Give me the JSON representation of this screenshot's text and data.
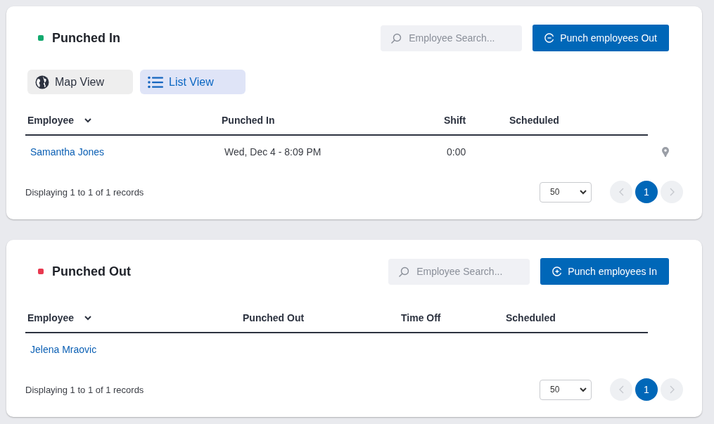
{
  "sections": [
    {
      "kind": "punched_in",
      "title": "Punched In",
      "color": "#12a96e",
      "search": {
        "placeholder": "Employee Search..."
      },
      "action_button": {
        "label": "Punch employees Out",
        "kind": "out"
      },
      "view_tabs": [
        {
          "label": "Map View",
          "kind": "map",
          "selected": false
        },
        {
          "label": "List View",
          "kind": "list",
          "selected": true
        }
      ],
      "table": {
        "columns": [
          {
            "label": "Employee",
            "sortable": true
          },
          {
            "label": "Punched In",
            "sortable": false
          },
          {
            "label": "Shift",
            "sortable": false
          },
          {
            "label": "Scheduled",
            "sortable": false
          }
        ],
        "rows": [
          {
            "cells": [
              "Samantha Jones",
              "Wed, Dec 4 - 8:09 PM",
              "0:00"
            ],
            "location": true
          }
        ]
      },
      "footer": {
        "summary": "Displaying 1 to 1 of 1 records",
        "page_size": "50",
        "prev_disabled": true,
        "next_disabled": true,
        "pages": [
          {
            "label": "1",
            "selected": true
          }
        ]
      }
    },
    {
      "kind": "punched_out",
      "title": "Punched Out",
      "color": "#e8384f",
      "search": {
        "placeholder": "Employee Search..."
      },
      "action_button": {
        "label": "Punch employees In",
        "kind": "in"
      },
      "table": {
        "columns": [
          {
            "label": "Employee",
            "sortable": true
          },
          {
            "label": "Punched Out",
            "sortable": false
          },
          {
            "label": "Time Off",
            "sortable": false
          },
          {
            "label": "Scheduled",
            "sortable": false
          }
        ],
        "rows": [
          {
            "cells": [
              "Jelena Mraovic"
            ],
            "location": false
          }
        ]
      },
      "footer": {
        "summary": "Displaying 1 to 1 of 1 records",
        "page_size": "50",
        "prev_disabled": true,
        "next_disabled": true,
        "pages": [
          {
            "label": "1",
            "selected": true
          }
        ]
      }
    }
  ]
}
